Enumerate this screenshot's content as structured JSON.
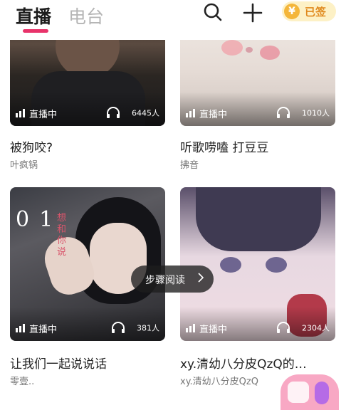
{
  "header": {
    "tab_live": "直播",
    "tab_radio": "电台",
    "signin_coin": "¥",
    "signin_label": "已签"
  },
  "cards": [
    {
      "status": "直播中",
      "listeners": "6445人",
      "title": "被狗咬?",
      "host": "叶疯锅"
    },
    {
      "status": "直播中",
      "listeners": "1010人",
      "title": "听歌唠嗑 打豆豆",
      "host": "拂音"
    },
    {
      "status": "直播中",
      "listeners": "381人",
      "title": "让我们一起说说话",
      "host": "零壹.."
    },
    {
      "status": "直播中",
      "listeners": "2304人",
      "title": "xy.清幼八分皮QzQ的…",
      "host": "xy.清幼八分皮QzQ"
    }
  ],
  "overlay": {
    "step_reading": "步骤阅读"
  },
  "thumbnail_text": {
    "digits": "01",
    "vertical_text": "想和你说"
  },
  "colors": {
    "accent": "#e8336a",
    "signin_bg": "#fdf1c6",
    "coin": "#f4b63a"
  }
}
